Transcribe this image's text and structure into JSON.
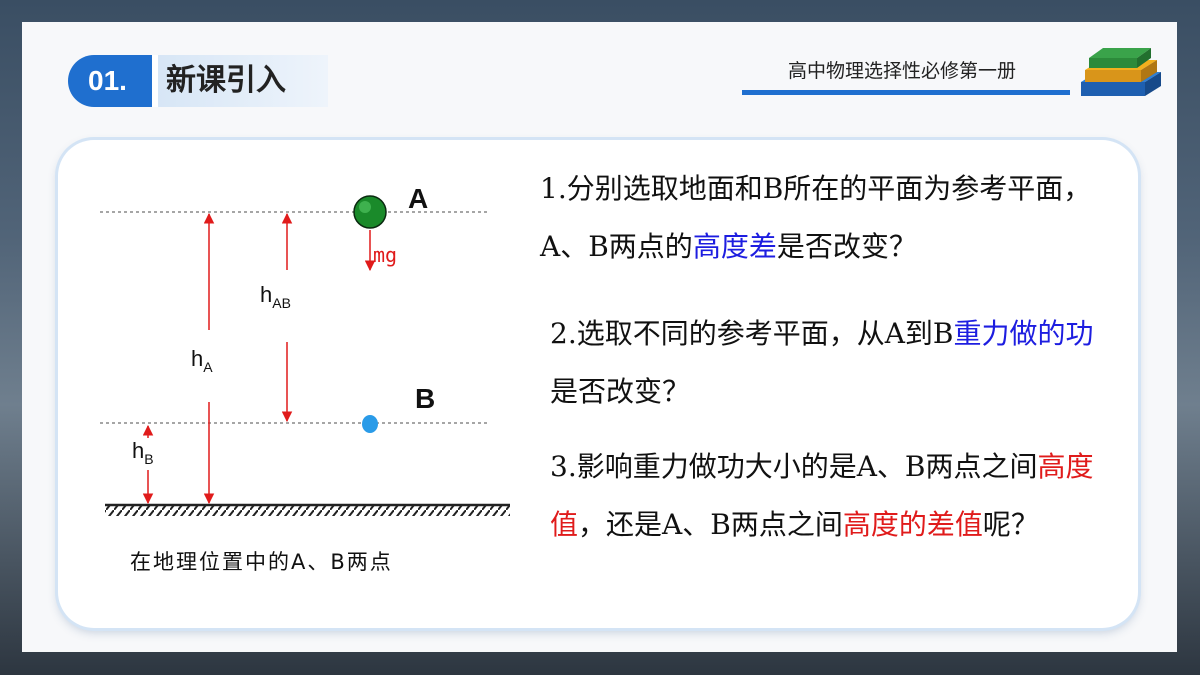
{
  "header": {
    "badge_number": "01.",
    "section_title": "新课引入",
    "book_title": "高中物理选择性必修第一册"
  },
  "diagram": {
    "label_A": "A",
    "label_B": "B",
    "label_mg": "mg",
    "label_h_A": "h",
    "sub_h_A": "A",
    "label_h_AB": "h",
    "sub_h_AB": "AB",
    "label_h_B": "h",
    "sub_h_B": "B",
    "caption": "在地理位置中的A、B两点"
  },
  "questions": {
    "q1": {
      "part1": "1.分别选取地面和B所在的平面为参考平面，A、B两点的",
      "highlight1": "高度差",
      "part2": "是否改变？"
    },
    "q2": {
      "part1": "2.选取不同的参考平面，从A到B",
      "highlight1": "重力做的功",
      "part2": "是否改变？"
    },
    "q3": {
      "part1": "3.影响重力做功大小的是A、B两点之间",
      "highlight1": "高度值",
      "part2": "，还是A、B两点之间",
      "highlight2": "高度的差值",
      "part3": "呢？"
    }
  },
  "colors": {
    "accent_blue": "#1f6fcf",
    "highlight_blue": "#1d1de0",
    "highlight_red": "#e01b1b",
    "ball_A": "#1a8a2a",
    "ball_B": "#2a9be8",
    "arrow_red": "#e01b1b"
  }
}
